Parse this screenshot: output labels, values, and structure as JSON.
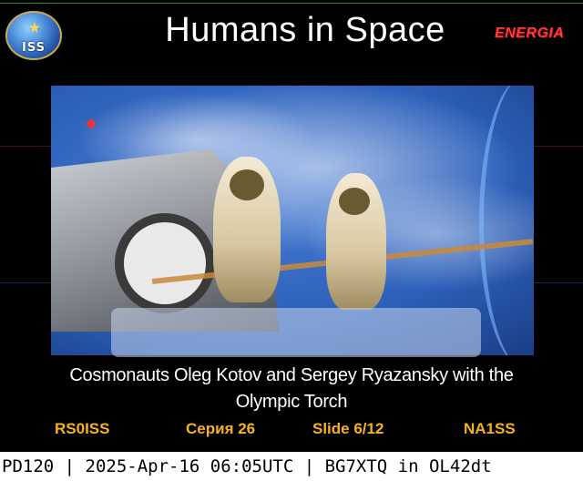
{
  "header": {
    "logo_text": "ISS",
    "title": "Humans in Space",
    "brand": "ENERGIA"
  },
  "caption": {
    "line1": "Cosmonauts Oleg Kotov and Sergey Ryazansky with the",
    "line2": "Olympic Torch"
  },
  "footer": {
    "callsign_left": "RS0ISS",
    "series": "Серия 26",
    "slide": "Slide 6/12",
    "callsign_right": "NA1SS"
  },
  "status_bar": {
    "text": "PD120 | 2025-Apr-16 06:05UTC | BG7XTQ in OL42dt"
  },
  "colors": {
    "footer_text": "#f5b31e",
    "brand_text": "#ff3b3b",
    "background": "#000000"
  }
}
